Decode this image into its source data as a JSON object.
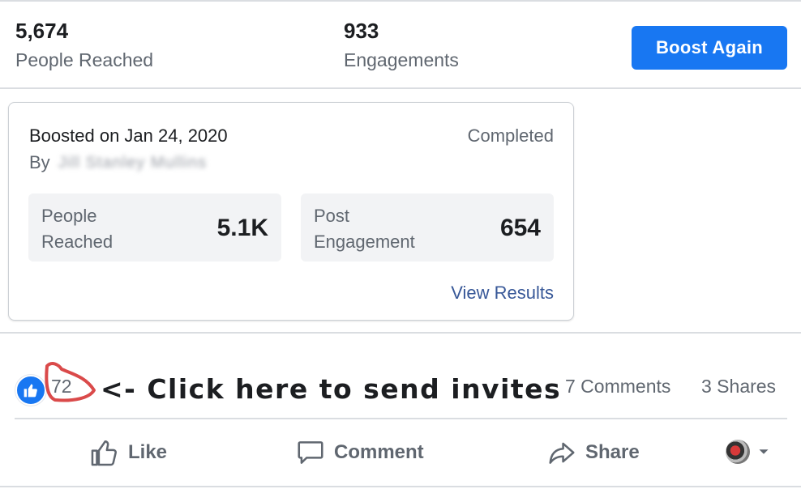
{
  "summary": {
    "people_reached_value": "5,674",
    "people_reached_label": "People Reached",
    "engagements_value": "933",
    "engagements_label": "Engagements",
    "boost_again_label": "Boost Again"
  },
  "boost_card": {
    "boosted_on": "Boosted on Jan 24, 2020",
    "status": "Completed",
    "by_label": "By",
    "by_name": "Jill Stanley Mullins",
    "metrics": [
      {
        "label": "People\nReached",
        "value": "5.1K"
      },
      {
        "label": "Post\nEngagement",
        "value": "654"
      }
    ],
    "view_results_label": "View Results"
  },
  "reactions": {
    "like_count": "72",
    "annotation": "<- Click here to send invites",
    "comments": "7 Comments",
    "shares": "3 Shares"
  },
  "actions": {
    "like": "Like",
    "comment": "Comment",
    "share": "Share"
  },
  "colors": {
    "brand_blue": "#1877f2",
    "link_blue": "#385898",
    "annotation_red": "#d42a2a",
    "muted_text": "#606770"
  },
  "icons": [
    "like-icon",
    "comment-icon",
    "share-icon",
    "chevron-down-icon",
    "thumbs-up-reaction-icon"
  ]
}
